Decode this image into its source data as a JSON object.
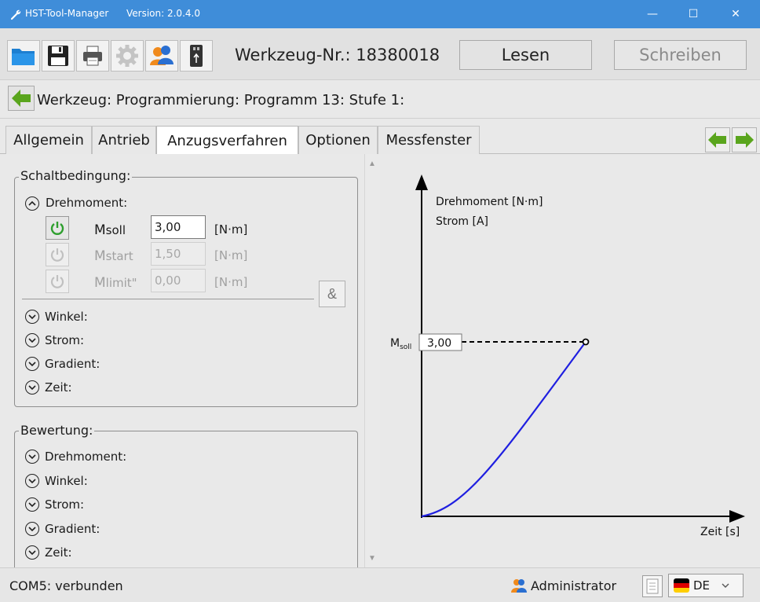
{
  "window": {
    "title": "HST-Tool-Manager",
    "version": "Version: 2.0.4.0",
    "app_icon": "wrench-icon",
    "buttons": {
      "minimize": "—",
      "maximize": "☐",
      "close": "✕"
    }
  },
  "toolbar": {
    "icons": [
      "folder-open-icon",
      "save-disk-icon",
      "printer-icon",
      "gear-icon",
      "users-icon",
      "usb-drive-icon"
    ],
    "tool_number_label": "Werkzeug-Nr.: 18380018",
    "read_label": "Lesen",
    "write_label": "Schreiben"
  },
  "breadcrumb": {
    "text": "Werkzeug: Programmierung: Programm 13: Stufe 1:"
  },
  "tabs": [
    {
      "label": "Allgemein"
    },
    {
      "label": "Antrieb"
    },
    {
      "label": "Anzugsverfahren"
    },
    {
      "label": "Optionen"
    },
    {
      "label": "Messfenster"
    }
  ],
  "switching_condition": {
    "title": "Schaltbedingung:",
    "torque_label": "Drehmoment:",
    "params": [
      {
        "name": "M",
        "sub": "soll",
        "value": "3,00",
        "unit": "[N·m]",
        "enabled": true
      },
      {
        "name": "M",
        "sub": "start",
        "value": "1,50",
        "unit": "[N·m]",
        "enabled": false
      },
      {
        "name": "M",
        "sub": "limit\"",
        "value": "0,00",
        "unit": "[N·m]",
        "enabled": false
      }
    ],
    "and_button": "&",
    "collapsed": [
      "Winkel:",
      "Strom:",
      "Gradient:",
      "Zeit:"
    ]
  },
  "evaluation": {
    "title": "Bewertung:",
    "collapsed": [
      "Drehmoment:",
      "Winkel:",
      "Strom:",
      "Gradient:",
      "Zeit:"
    ]
  },
  "chart": {
    "y_label_1": "Drehmoment [N·m]",
    "y_label_2": "Strom [A]",
    "x_label": "Zeit [s]",
    "marker_name": "M",
    "marker_sub": "soll",
    "marker_value": "3,00",
    "curve_color": "#1f1fe0"
  },
  "status": {
    "connection": "COM5: verbunden",
    "user": "Administrator",
    "language": "DE"
  }
}
